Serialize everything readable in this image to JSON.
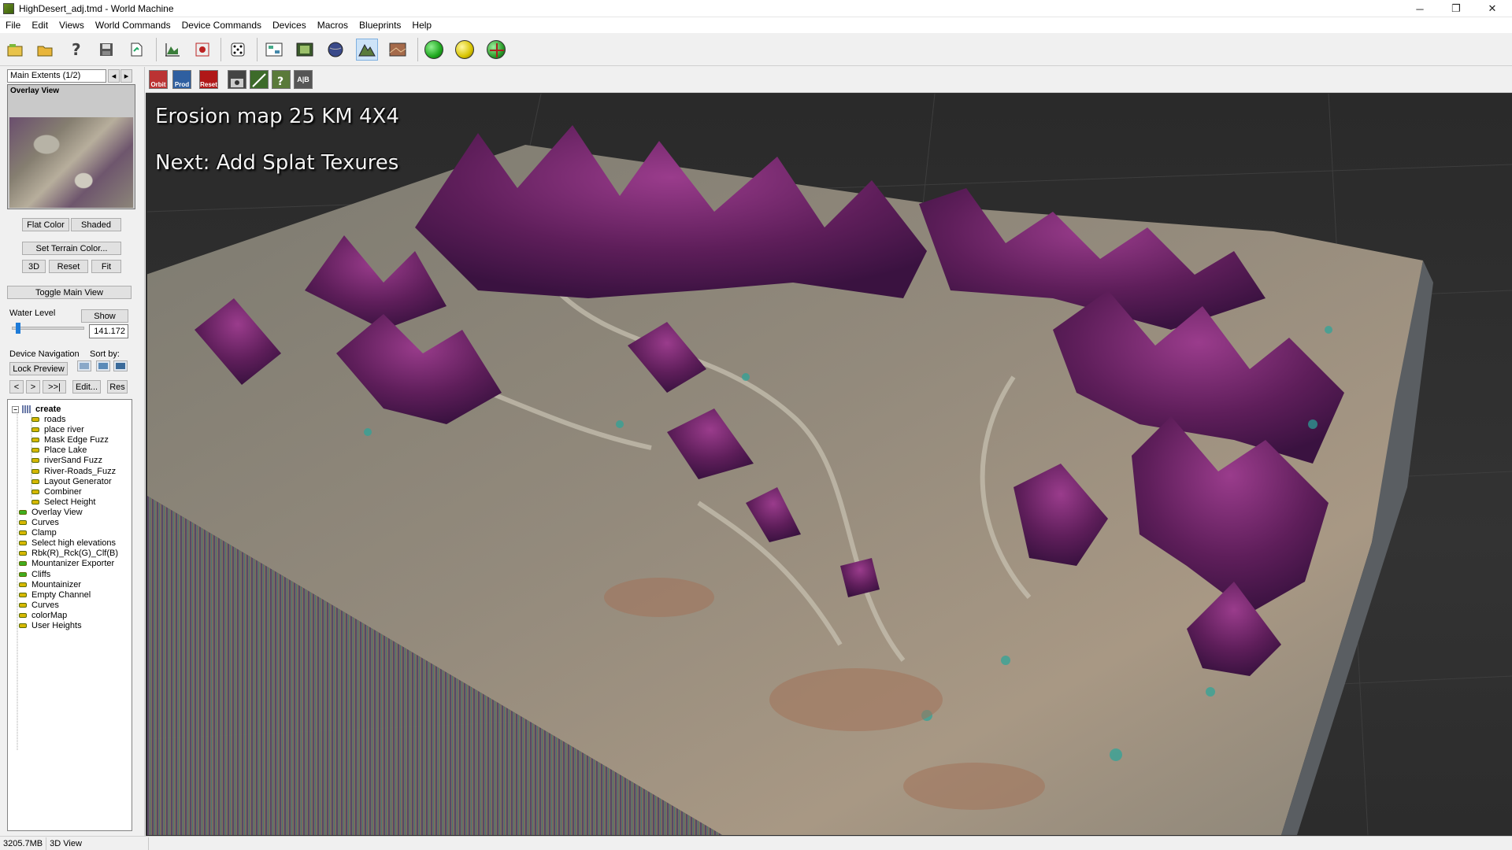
{
  "window": {
    "title": "HighDesert_adj.tmd - World Machine",
    "controls": {
      "minimize": "─",
      "restore": "❐",
      "close": "✕"
    }
  },
  "menu": [
    "File",
    "Edit",
    "Views",
    "World Commands",
    "Device Commands",
    "Devices",
    "Macros",
    "Blueprints",
    "Help"
  ],
  "toolbar": {
    "icons": [
      "new-icon",
      "open-icon",
      "help-icon",
      "save-icon",
      "export-icon",
      "chart-icon",
      "settings-icon",
      "dice-icon",
      "layout-icon",
      "film-icon",
      "globe-icon",
      "terrain-icon",
      "texture-icon",
      "build-green-icon",
      "build-yellow-icon",
      "build-world-icon"
    ],
    "colors": {
      "green_orb": "#1fa81f",
      "yellow_orb": "#d8c400",
      "world_orb": "#2b9c2b"
    }
  },
  "left_panel": {
    "extents": "Main Extents (1/2)",
    "preview_title": "Overlay View",
    "buttons": {
      "flat_color": "Flat Color",
      "shaded": "Shaded",
      "set_terrain_color": "Set Terrain Color...",
      "three_d": "3D",
      "reset": "Reset",
      "fit": "Fit",
      "toggle_main_view": "Toggle Main View",
      "show": "Show",
      "lock_preview": "Lock Preview",
      "edit": "Edit...",
      "res": "Res",
      "nav_prev": "<",
      "nav_next": ">",
      "nav_last": ">>|"
    },
    "water_level_label": "Water Level",
    "water_level_value": "141.172",
    "water_level_fraction": 0.05,
    "device_navigation_label": "Device Navigation",
    "sort_by_label": "Sort by:",
    "tree": {
      "root": "create",
      "children": [
        "roads",
        "place river",
        "Mask Edge Fuzz",
        "Place Lake",
        "riverSand Fuzz",
        "River-Roads_Fuzz",
        "Layout Generator",
        "Combiner",
        "Select Height"
      ],
      "items": [
        "Overlay View",
        "Curves",
        "Clamp",
        "Select high elevations",
        "Rbk(R)_Rck(G)_Clf(B)",
        "Mountanizer Exporter",
        "Cliffs",
        "Mountainizer",
        "Empty Channel",
        "Curves",
        "colorMap",
        "User Heights"
      ]
    }
  },
  "view_toolbar": {
    "buttons": [
      "Orbit",
      "Prod",
      "Reset",
      "",
      "",
      "",
      "A|B"
    ]
  },
  "viewport": {
    "caption_line1": "Erosion map  25 KM 4X4",
    "caption_line2": "Next: Add Splat Texures"
  },
  "status": {
    "memory": "3205.7MB",
    "view": "3D View"
  }
}
